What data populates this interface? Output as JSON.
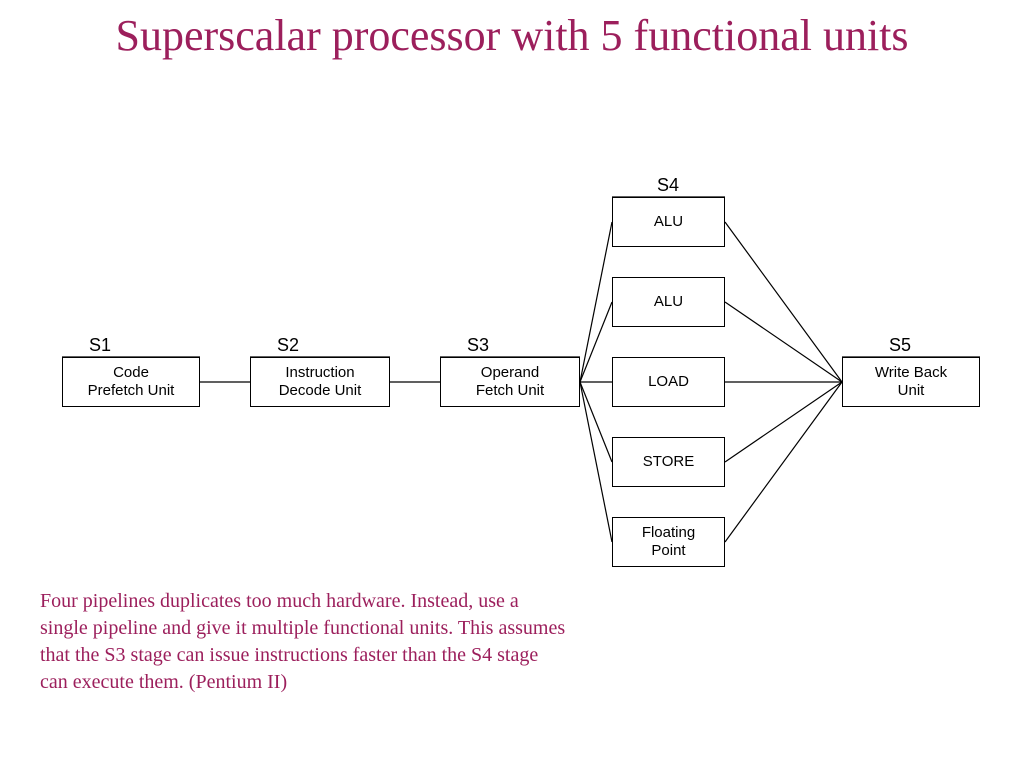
{
  "title": "Superscalar processor with 5 functional units",
  "stages": {
    "s1": {
      "label": "S1",
      "box": "Code\nPrefetch Unit"
    },
    "s2": {
      "label": "S2",
      "box": "Instruction\nDecode Unit"
    },
    "s3": {
      "label": "S3",
      "box": "Operand\nFetch Unit"
    },
    "s4": {
      "label": "S4",
      "units": [
        "ALU",
        "ALU",
        "LOAD",
        "STORE",
        "Floating\nPoint"
      ]
    },
    "s5": {
      "label": "S5",
      "box": "Write Back\nUnit"
    }
  },
  "caption": "Four pipelines duplicates too much hardware. Instead, use a single pipeline and give it multiple functional units.  This assumes that the S3 stage can issue instructions faster than the S4 stage can execute them. (Pentium II)"
}
